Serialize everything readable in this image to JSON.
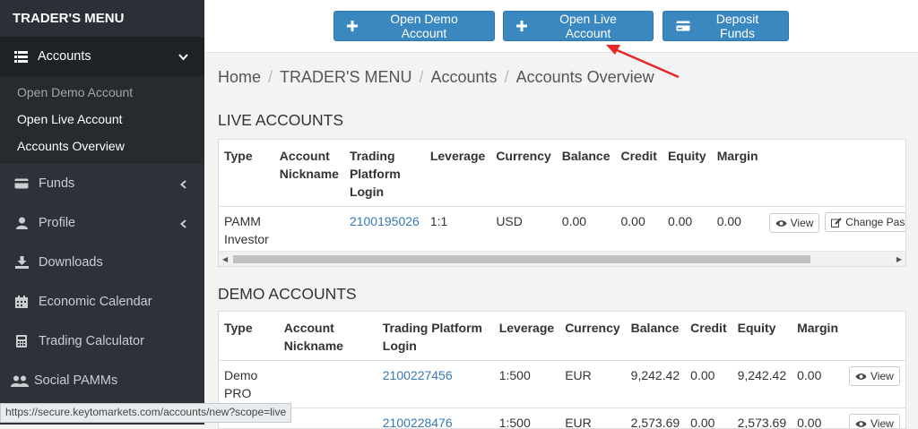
{
  "sidebar": {
    "brand": "TRADER'S MENU",
    "active": {
      "label": "Accounts",
      "icon": "list-icon"
    },
    "subitems": [
      "Open Demo Account",
      "Open Live Account",
      "Accounts Overview"
    ],
    "items": [
      {
        "label": "Funds",
        "icon": "credit-card-icon"
      },
      {
        "label": "Profile",
        "icon": "user-icon"
      },
      {
        "label": "Downloads",
        "icon": "download-icon"
      },
      {
        "label": "Economic Calendar",
        "icon": "calendar-icon"
      },
      {
        "label": "Trading Calculator",
        "icon": "calculator-icon"
      },
      {
        "label": "Social PAMMs",
        "icon": "users-icon"
      }
    ]
  },
  "toolbar": {
    "open_demo": "Open Demo Account",
    "open_live": "Open Live Account",
    "deposit": "Deposit Funds"
  },
  "breadcrumb": [
    "Home",
    "TRADER'S MENU",
    "Accounts",
    "Accounts Overview"
  ],
  "live": {
    "title": "LIVE ACCOUNTS",
    "headers": [
      "Type",
      "Account Nickname",
      "Trading Platform Login",
      "Leverage",
      "Currency",
      "Balance",
      "Credit",
      "Equity",
      "Margin"
    ],
    "rows": [
      {
        "type": "PAMM Investor",
        "nickname": "",
        "login": "2100195026",
        "leverage": "1:1",
        "currency": "USD",
        "balance": "0.00",
        "credit": "0.00",
        "equity": "0.00",
        "margin": "0.00"
      }
    ],
    "view_label": "View",
    "change_label": "Change Passw"
  },
  "demo": {
    "title": "DEMO ACCOUNTS",
    "headers": [
      "Type",
      "Account Nickname",
      "Trading Platform Login",
      "Leverage",
      "Currency",
      "Balance",
      "Credit",
      "Equity",
      "Margin"
    ],
    "rows": [
      {
        "type": "Demo PRO",
        "nickname": "",
        "login": "2100227456",
        "leverage": "1:500",
        "currency": "EUR",
        "balance": "9,242.42",
        "credit": "0.00",
        "equity": "9,242.42",
        "margin": "0.00"
      },
      {
        "type": "",
        "nickname": "",
        "login": "2100228476",
        "leverage": "1:500",
        "currency": "EUR",
        "balance": "2,573.69",
        "credit": "0.00",
        "equity": "2,573.69",
        "margin": "0.00"
      }
    ],
    "view_label": "View"
  },
  "status_url": "https://secure.keytomarkets.com/accounts/new?scope=live",
  "colors": {
    "primary": "#3b88c1",
    "sidebar": "#2c3238",
    "link": "#3878b0",
    "annotation": "#e8262a"
  }
}
